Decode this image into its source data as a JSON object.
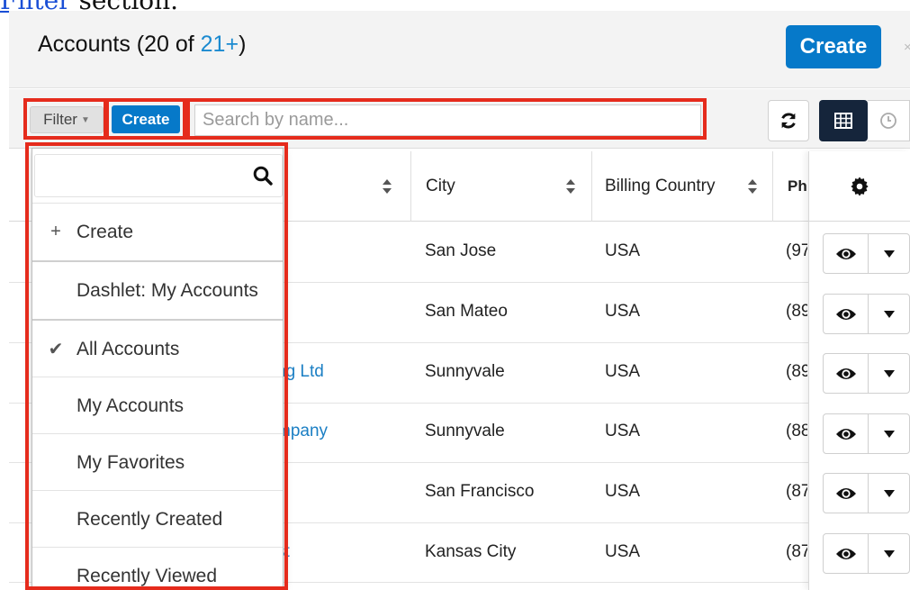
{
  "caption": {
    "link": "Filter",
    "rest": " section."
  },
  "header": {
    "title": "Accounts (20 of ",
    "count": "21+",
    "title_end": ")",
    "create_label": "Create",
    "close": "×"
  },
  "toolbar": {
    "filter_label": "Filter",
    "create_label": "Create",
    "search_placeholder": "Search by name..."
  },
  "columns": {
    "city": "City",
    "billing_country": "Billing Country",
    "phone": "Ph"
  },
  "rows": [
    {
      "name": "",
      "city": "San Jose",
      "country": "USA",
      "phone": "(97"
    },
    {
      "name": "",
      "city": "San Mateo",
      "country": "USA",
      "phone": "(89"
    },
    {
      "name": "ng Ltd",
      "city": "Sunnyvale",
      "country": "USA",
      "phone": "(89"
    },
    {
      "name": "mpany",
      "city": "Sunnyvale",
      "country": "USA",
      "phone": "(88"
    },
    {
      "name": "",
      "city": "San Francisco",
      "country": "USA",
      "phone": "(87"
    },
    {
      "name": "st",
      "city": "Kansas City",
      "country": "USA",
      "phone": "(87"
    }
  ],
  "filter_menu": {
    "search_placeholder": "",
    "create_label": "Create",
    "items": [
      "Dashlet: My Accounts",
      "All Accounts",
      "My Accounts",
      "My Favorites",
      "Recently Created",
      "Recently Viewed"
    ],
    "selected": "All Accounts"
  },
  "icons": {
    "refresh": "refresh-icon",
    "grid": "list-view-icon",
    "clock": "activity-stream-icon",
    "gear": "gear-icon",
    "eye": "eye-icon",
    "caret": "caret-down-icon",
    "search": "search-icon",
    "plus": "plus-icon",
    "check": "check-icon"
  },
  "colors": {
    "primary": "#0679c9",
    "highlight": "#e52b1c",
    "link": "#1b7fc4",
    "dark_toggle": "#15253b"
  }
}
